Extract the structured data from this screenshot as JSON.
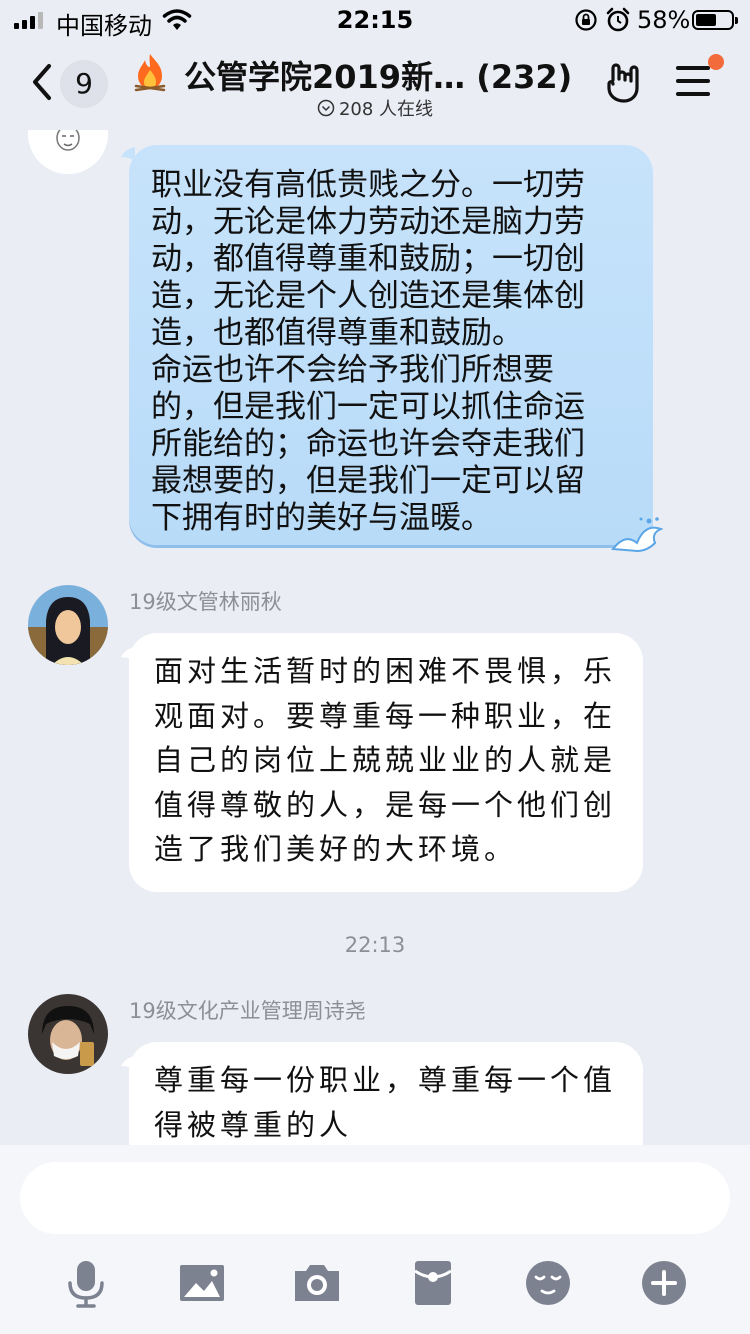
{
  "status_bar": {
    "carrier": "中国移动",
    "time": "22:15",
    "battery_percent": "58%",
    "battery_level": 0.58
  },
  "header": {
    "unread_count": "9",
    "group_title": "公管学院2019新… (232)",
    "online_text": "208 人在线"
  },
  "messages": [
    {
      "type": "incoming",
      "sender": "",
      "bubble_style": "blue",
      "text": "职业没有高低贵贱之分。一切劳\n动，无论是体力劳动还是脑力劳\n动，都值得尊重和鼓励；一切创\n造，无论是个人创造还是集体创\n造，也都值得尊重和鼓励。\n命运也许不会给予我们所想要\n的，但是我们一定可以抓住命运\n所能给的；命运也许会夺走我们\n最想要的，但是我们一定可以留\n下拥有时的美好与温暖。"
    },
    {
      "type": "incoming",
      "sender": "19级文管林丽秋",
      "bubble_style": "white",
      "text": "面对生活暂时的困难不畏惧，乐\n观面对。要尊重每一种职业，在\n自己的岗位上兢兢业业的人就是\n值得尊敬的人，是每一个他们创\n造了我们美好的大环境。"
    },
    {
      "type": "timestamp",
      "text": "22:13"
    },
    {
      "type": "incoming",
      "sender": "19级文化产业管理周诗尧",
      "bubble_style": "white",
      "text": "尊重每一份职业，尊重每一个值\n得被尊重的人"
    }
  ],
  "composer": {
    "input_value": "",
    "tools": [
      "microphone-icon",
      "image-icon",
      "camera-icon",
      "red-packet-icon",
      "emoji-icon",
      "plus-icon"
    ]
  },
  "colors": {
    "background": "#ebedf5",
    "blue_bubble": "#c7e3fb",
    "notification_dot": "#f26b3a",
    "icon_gray": "#7d8291"
  }
}
